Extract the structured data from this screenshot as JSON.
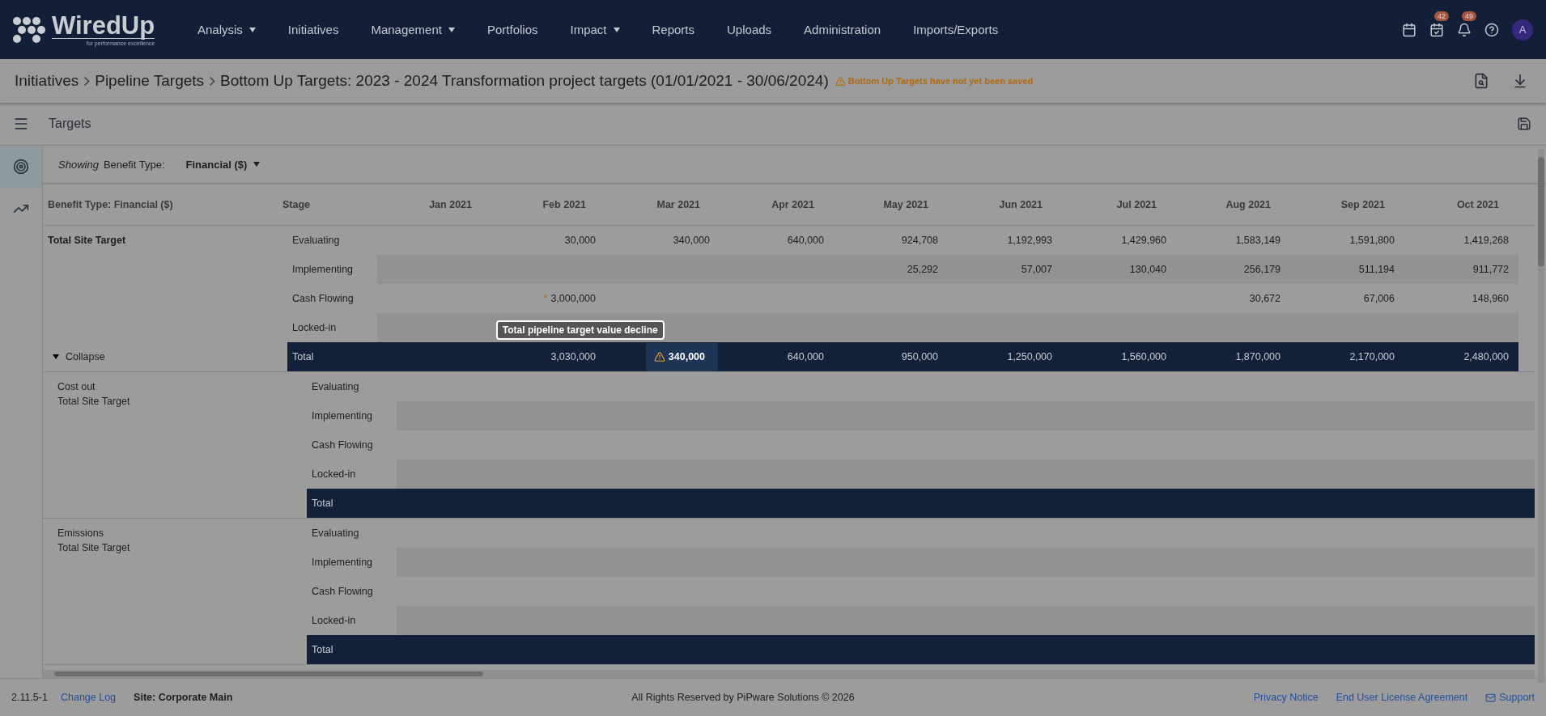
{
  "nav": {
    "logo": {
      "name": "WiredUp",
      "tagline": "for performance excellence"
    },
    "items": [
      {
        "label": "Analysis",
        "dropdown": true
      },
      {
        "label": "Initiatives",
        "dropdown": false
      },
      {
        "label": "Management",
        "dropdown": true
      },
      {
        "label": "Portfolios",
        "dropdown": false
      },
      {
        "label": "Impact",
        "dropdown": true
      },
      {
        "label": "Reports",
        "dropdown": false
      },
      {
        "label": "Uploads",
        "dropdown": false
      },
      {
        "label": "Administration",
        "dropdown": false
      },
      {
        "label": "Imports/Exports",
        "dropdown": false
      }
    ],
    "tools": [
      {
        "kind": "calendar"
      },
      {
        "kind": "tasks",
        "badge": "42"
      },
      {
        "kind": "bell",
        "badge": "49"
      },
      {
        "kind": "help"
      }
    ],
    "avatar": "A"
  },
  "breadcrumb": {
    "items": [
      "Initiatives",
      "Pipeline Targets"
    ],
    "title": "Bottom Up Targets: 2023 - 2024 Transformation project targets (01/01/2021 - 30/06/2024)",
    "warning": "Bottom Up Targets have not yet been saved"
  },
  "panel": {
    "title": "Targets"
  },
  "side_tabs": [
    {
      "kind": "target",
      "selected": true
    },
    {
      "kind": "chart",
      "selected": false
    }
  ],
  "filter": {
    "showing": "Showing",
    "label": "Benefit Type:",
    "value": "Financial ($)"
  },
  "table": {
    "columns": [
      "Benefit Type: Financial ($)",
      "Stage",
      "Jan 2021",
      "Feb 2021",
      "Mar 2021",
      "Apr 2021",
      "May 2021",
      "Jun 2021",
      "Jul 2021",
      "Aug 2021",
      "Sep 2021",
      "Oct 2021"
    ],
    "groups": [
      {
        "labels": [
          "Total Site Target"
        ],
        "bold": true,
        "toggle": {
          "label": "Collapse",
          "expanded": true
        },
        "rows": [
          {
            "kind": "stage",
            "stage": "Evaluating",
            "values": [
              {
                "kind": "blank"
              },
              "30,000",
              "340,000",
              "640,000",
              "924,708",
              "1,192,993",
              "1,429,960",
              "1,583,149",
              "1,591,800",
              "1,419,268"
            ]
          },
          {
            "kind": "stage",
            "stage": "Implementing",
            "values": [
              {
                "kind": "blank"
              },
              {
                "kind": "blank"
              },
              {
                "kind": "blank"
              },
              {
                "kind": "blank"
              },
              "25,292",
              "57,007",
              "130,040",
              "256,179",
              "511,194",
              "911,772"
            ]
          },
          {
            "kind": "stage",
            "stage": "Cash Flowing",
            "values": [
              {
                "kind": "blank"
              },
              {
                "kind": "flagged",
                "text": "3,000,000",
                "flag": "*"
              },
              {
                "kind": "blank"
              },
              {
                "kind": "blank"
              },
              {
                "kind": "blank"
              },
              {
                "kind": "blank"
              },
              {
                "kind": "blank"
              },
              "30,672",
              "67,006",
              "148,960"
            ]
          },
          {
            "kind": "stage",
            "stage": "Locked-in"
          },
          {
            "kind": "total",
            "stage": "Total",
            "values": [
              {
                "kind": "blank"
              },
              "3,030,000",
              {
                "kind": "warning",
                "text": "340,000",
                "tooltip": "Total pipeline target value decline"
              },
              "640,000",
              "950,000",
              "1,250,000",
              "1,560,000",
              "1,870,000",
              "2,170,000",
              "2,480,000"
            ]
          }
        ]
      },
      {
        "labels": [
          "Cost out",
          "Total Site Target"
        ],
        "bold": false,
        "rows": [
          {
            "kind": "stage",
            "stage": "Evaluating"
          },
          {
            "kind": "stage",
            "stage": "Implementing"
          },
          {
            "kind": "stage",
            "stage": "Cash Flowing"
          },
          {
            "kind": "stage",
            "stage": "Locked-in"
          },
          {
            "kind": "total",
            "stage": "Total"
          }
        ]
      },
      {
        "labels": [
          "Emissions",
          "Total Site Target"
        ],
        "bold": false,
        "rows": [
          {
            "kind": "stage",
            "stage": "Evaluating"
          },
          {
            "kind": "stage",
            "stage": "Implementing"
          },
          {
            "kind": "stage",
            "stage": "Cash Flowing"
          },
          {
            "kind": "stage",
            "stage": "Locked-in"
          },
          {
            "kind": "total",
            "stage": "Total"
          }
        ]
      }
    ]
  },
  "footer": {
    "version": "2.11.5-1",
    "change_log": "Change Log",
    "site": "Site: Corporate Main",
    "copyright": "All Rights Reserved by PiPware Solutions © 2026",
    "links": [
      "Privacy Notice",
      "End User License Agreement"
    ],
    "support": "Support"
  }
}
